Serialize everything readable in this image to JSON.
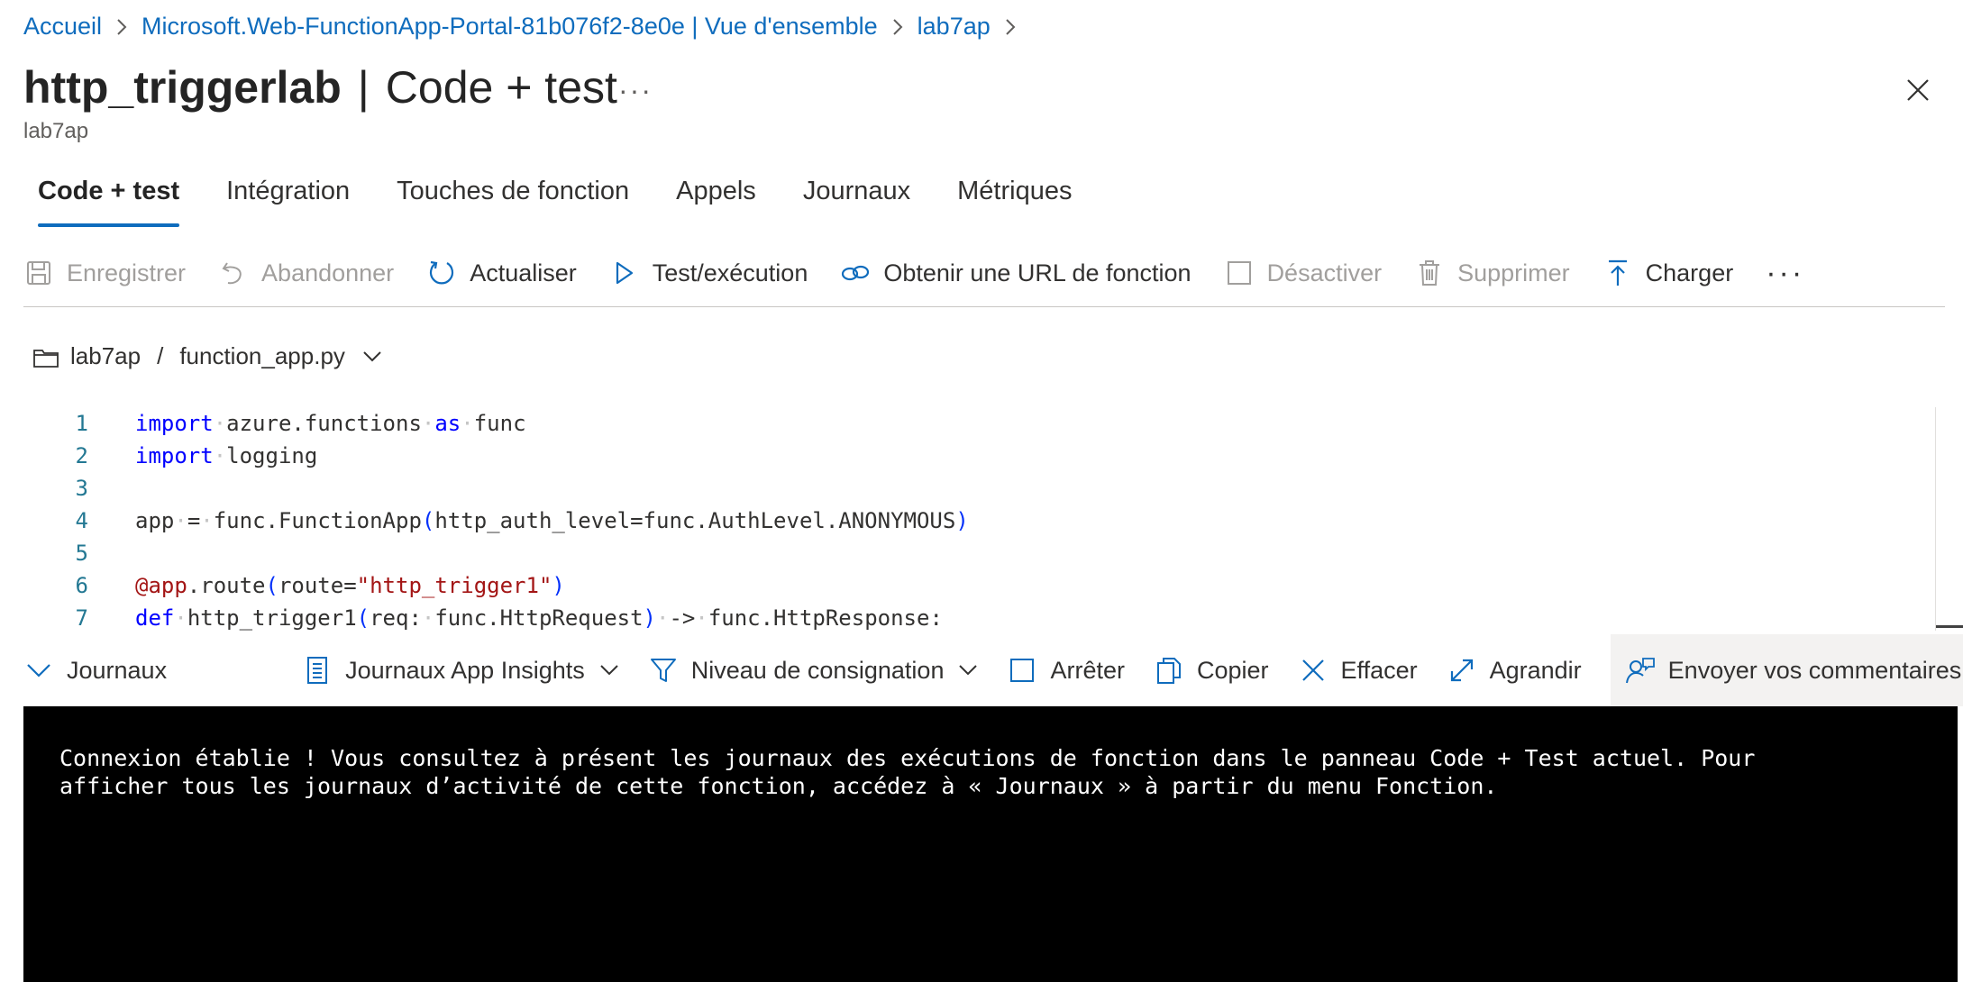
{
  "breadcrumb": {
    "items": [
      "Accueil",
      "Microsoft.Web-FunctionApp-Portal-81b076f2-8e0e | Vue d'ensemble",
      "lab7ap"
    ]
  },
  "header": {
    "title": "http_triggerlab",
    "title_separator": "|",
    "subtitle_view": "Code + test",
    "more": "···",
    "resource": "lab7ap"
  },
  "tabs": [
    {
      "label": "Code + test",
      "active": true
    },
    {
      "label": "Intégration"
    },
    {
      "label": "Touches de fonction"
    },
    {
      "label": "Appels"
    },
    {
      "label": "Journaux"
    },
    {
      "label": "Métriques"
    }
  ],
  "toolbar": {
    "save": "Enregistrer",
    "discard": "Abandonner",
    "refresh": "Actualiser",
    "test_run": "Test/exécution",
    "get_url": "Obtenir une URL de fonction",
    "disable": "Désactiver",
    "delete": "Supprimer",
    "upload": "Charger",
    "more": "···"
  },
  "file_path": {
    "folder": "lab7ap",
    "separator": "/",
    "file": "function_app.py"
  },
  "editor": {
    "line_numbers": [
      "1",
      "2",
      "3",
      "4",
      "5",
      "6",
      "7"
    ],
    "tokens": {
      "l1_import": "import",
      "l1_module": "azure.functions",
      "l1_as": "as",
      "l1_alias": "func",
      "l2_import": "import",
      "l2_module": "logging",
      "l4_lhs": "app",
      "l4_eq": "=",
      "l4_call": "func.FunctionApp",
      "l4_open": "(",
      "l4_args": "http_auth_level=func.AuthLevel.ANONYMOUS",
      "l4_close": ")",
      "l6_dec": "@app",
      "l6_attr": ".route",
      "l6_open": "(",
      "l6_kw": "route=",
      "l6_str": "\"http_trigger1\"",
      "l6_close": ")",
      "l7_def": "def",
      "l7_name": "http_trigger1",
      "l7_open": "(",
      "l7_param": "req:",
      "l7_type": "func.HttpRequest",
      "l7_close": ")",
      "l7_arrow": "->",
      "l7_ret": "func.HttpResponse:"
    }
  },
  "logs_bar": {
    "logs": "Journaux",
    "app_insights": "Journaux App Insights",
    "log_level": "Niveau de consignation",
    "stop": "Arrêter",
    "copy": "Copier",
    "clear": "Effacer",
    "expand": "Agrandir",
    "feedback": "Envoyer vos commentaires"
  },
  "console": {
    "line1": "Connexion établie ! Vous consultez à présent les journaux des exécutions de fonction dans le panneau Code + Test actuel. Pour",
    "line2": "afficher tous les journaux d’activité de cette fonction, accédez à « Journaux » à partir du menu Fonction."
  },
  "colors": {
    "link": "#0f6cbd",
    "accent": "#0f6cbd",
    "keyword": "#0000ff",
    "string": "#a31515",
    "line_number": "#237893",
    "console_bg": "#000000"
  }
}
